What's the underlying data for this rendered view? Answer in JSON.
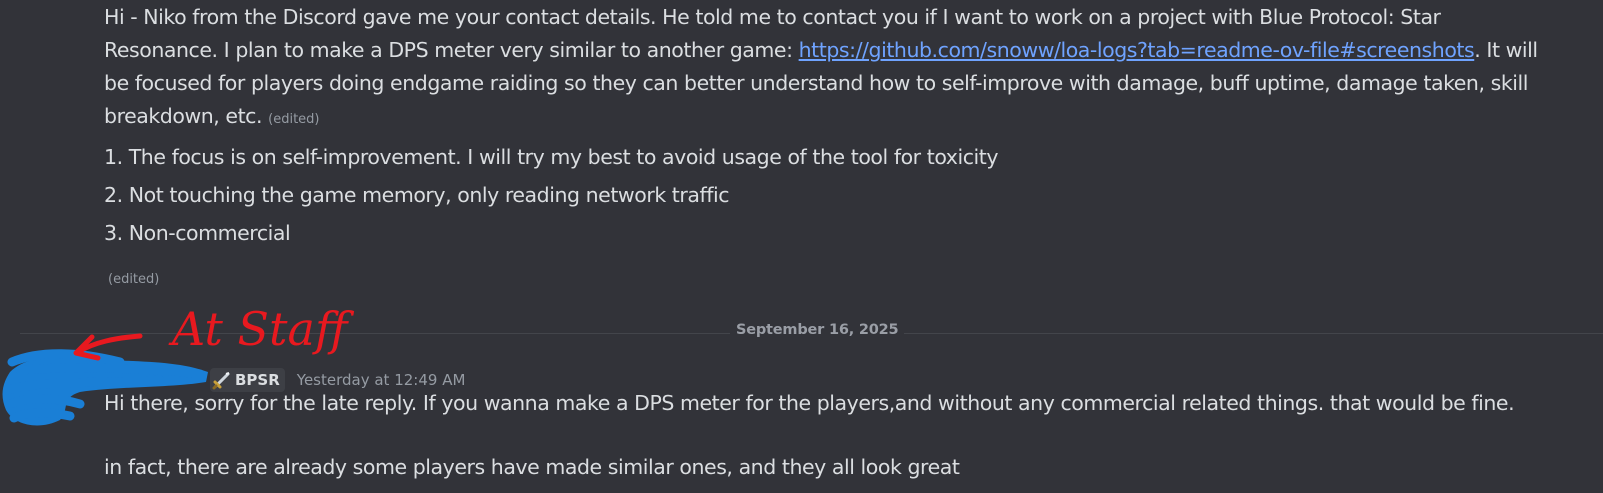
{
  "message1": {
    "line1": "Hi - Niko from the Discord gave me your contact details. He told me to contact you if I want to work on a project with Blue Protocol: Star",
    "line2_prefix": "Resonance. I plan to make a DPS meter very similar to another game: ",
    "link": "https://github.com/snoww/loa-logs?tab=readme-ov-file#screenshots",
    "line2_suffix": ". It will",
    "line3": "be focused for players doing endgame raiding so they can better understand how to self-improve with damage, buff uptime, damage taken, skill",
    "line4": "breakdown, etc.",
    "edited_label": "(edited)",
    "list": [
      "1. The focus is on self-improvement. I will try my best to avoid usage of the tool for toxicity",
      "2. Not touching the game memory, only reading network traffic",
      "3. Non-commercial"
    ],
    "edited_label_2": "(edited)"
  },
  "date_divider": "September 16, 2025",
  "annotation": "At Staff",
  "message2": {
    "tag": "BPSR",
    "tag_icon": "sword-icon",
    "timestamp": "Yesterday at 12:49 AM",
    "line1": "Hi there, sorry for the late reply. If you wanna make a DPS meter for the players,and without any commercial related things. that would be fine.",
    "line2": "in fact, there are already some players have made similar ones, and they all look great"
  },
  "colors": {
    "background": "#323339",
    "text": "#dbdee1",
    "link": "#6fa3ff",
    "annotation_red": "#e8191f",
    "scribble_blue": "#1a7fd6"
  }
}
